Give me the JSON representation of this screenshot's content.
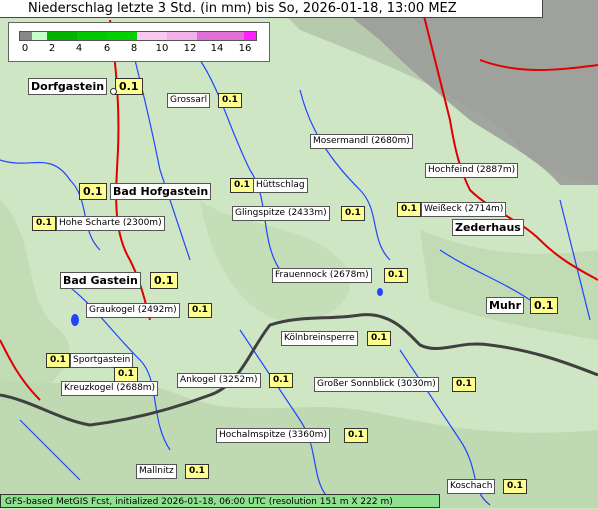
{
  "title": "Niederschlag letzte 3 Std. (in mm) bis So, 2026-01-18, 13:00 MEZ",
  "legend": {
    "ticks": [
      "0",
      "2",
      "4",
      "6",
      "8",
      "10",
      "12",
      "14",
      "16"
    ],
    "colors": [
      "#888888",
      "#c8ffc8",
      "#00b400",
      "#00d200",
      "#f8c8f0",
      "#e8a0e0",
      "#e070d8",
      "#ff20ff"
    ]
  },
  "colors": {
    "terrain": "#cfe6c4",
    "rivers": "#2244ff",
    "roads": "#e00000",
    "border": "#404040",
    "rock": "#9a9a9a"
  },
  "places": [
    {
      "id": "dorfgastein",
      "name": "Dorfgastein",
      "value": "0.1"
    },
    {
      "id": "grossarl",
      "name": "Grossarl",
      "value": "0.1"
    },
    {
      "id": "mosermandl",
      "name": "Mosermandl (2680m)",
      "value": ""
    },
    {
      "id": "hochfeind",
      "name": "Hochfeind (2887m)",
      "value": ""
    },
    {
      "id": "bad-hofgastein",
      "name": "Bad Hofgastein",
      "value": "0.1"
    },
    {
      "id": "huettschlag",
      "name": "Hüttschlag",
      "value": "0.1"
    },
    {
      "id": "hohe-scharte",
      "name": "Hohe Scharte (2300m)",
      "value": "0.1"
    },
    {
      "id": "glingspitze",
      "name": "Glingspitze (2433m)",
      "value": "0.1"
    },
    {
      "id": "weisseck",
      "name": "Weißeck (2714m)",
      "value": "0.1"
    },
    {
      "id": "zederhaus",
      "name": "Zederhaus",
      "value": ""
    },
    {
      "id": "bad-gastein",
      "name": "Bad Gastein",
      "value": "0.1"
    },
    {
      "id": "frauennock",
      "name": "Frauennock (2678m)",
      "value": "0.1"
    },
    {
      "id": "graukogel",
      "name": "Graukogel (2492m)",
      "value": "0.1"
    },
    {
      "id": "muhr",
      "name": "Muhr",
      "value": "0.1"
    },
    {
      "id": "koelnbreinsperre",
      "name": "Kölnbreinsperre",
      "value": "0.1"
    },
    {
      "id": "sportgastein",
      "name": "Sportgastein",
      "value": "0.1"
    },
    {
      "id": "kreuzkogel",
      "name": "Kreuzkogel (2688m)",
      "value": "0.1"
    },
    {
      "id": "ankogel",
      "name": "Ankogel (3252m)",
      "value": "0.1"
    },
    {
      "id": "sonnblick",
      "name": "Großer Sonnblick (3030m)",
      "value": "0.1"
    },
    {
      "id": "hochalmspitze",
      "name": "Hochalmspitze (3360m)",
      "value": "0.1"
    },
    {
      "id": "mallnitz",
      "name": "Mallnitz",
      "value": "0.1"
    },
    {
      "id": "koschach",
      "name": "Koschach",
      "value": "0.1"
    }
  ],
  "footer": "GFS-based MetGIS Fcst, initialized 2026-01-18, 06:00 UTC  (resolution 151 m X 222 m)"
}
